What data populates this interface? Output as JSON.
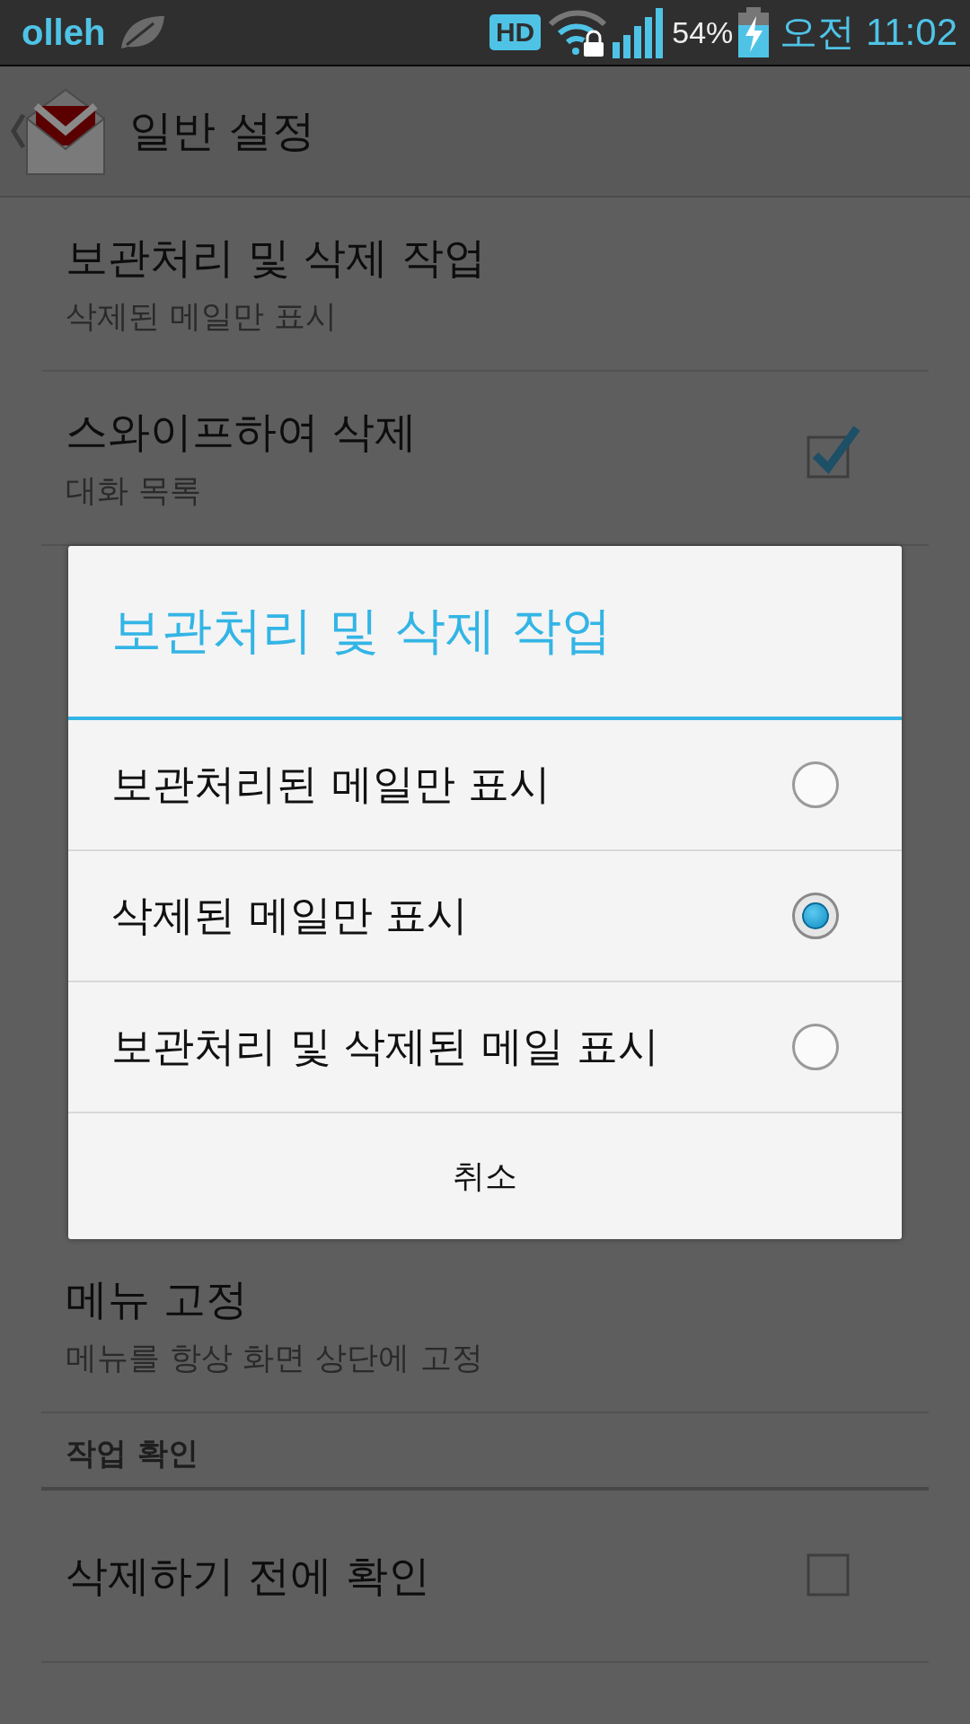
{
  "status_bar": {
    "carrier": "olleh",
    "network_badge": "HD",
    "battery": "54%",
    "time": "오전 11:02"
  },
  "action_bar": {
    "title": "일반 설정"
  },
  "settings": [
    {
      "kind": "row",
      "title": "보관처리 및 삭제 작업",
      "summary": "삭제된 메일만 표시"
    },
    {
      "kind": "checkbox",
      "title": "스와이프하여 삭제",
      "summary": "대화 목록",
      "checked": true
    },
    {
      "kind": "dialog_slot"
    },
    {
      "kind": "row",
      "title": "메뉴 고정",
      "summary": "메뉴를 항상 화면 상단에 고정"
    },
    {
      "kind": "header",
      "title": "작업 확인"
    },
    {
      "kind": "checkbox",
      "title": "삭제하기 전에 확인",
      "checked": false
    }
  ],
  "dialog": {
    "title": "보관처리 및 삭제 작업",
    "options": [
      {
        "label": "보관처리된 메일만 표시",
        "selected": false
      },
      {
        "label": "삭제된 메일만 표시",
        "selected": true
      },
      {
        "label": "보관처리 및 삭제된 메일 표시",
        "selected": false
      }
    ],
    "cancel": "취소"
  }
}
